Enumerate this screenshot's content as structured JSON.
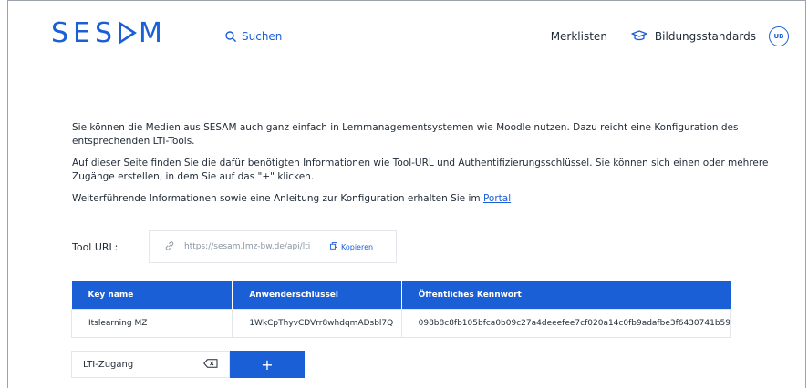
{
  "header": {
    "logo_text": "SESAM",
    "search_label": "Suchen",
    "nav_merklisten": "Merklisten",
    "nav_bildungsstandards": "Bildungsstandards",
    "avatar_initials": "UB"
  },
  "intro": {
    "p1": "Sie können die Medien aus SESAM auch ganz einfach in Lernmanagementsystemen wie Moodle nutzen. Dazu reicht eine Konfiguration des entsprechenden LTI-Tools.",
    "p2": "Auf dieser Seite finden Sie die dafür benötigten Informationen wie Tool-URL und Authentifizierungsschlüssel. Sie können sich einen oder mehrere Zugänge erstellen, in dem Sie auf das \"+\" klicken.",
    "p3_prefix": "Weiterführende Informationen sowie eine Anleitung zur Konfiguration erhalten Sie im ",
    "p3_link": "Portal"
  },
  "tool": {
    "label": "Tool URL:",
    "url": "https://sesam.lmz-bw.de/api/lti",
    "copy_label": "Kopieren"
  },
  "table": {
    "headers": [
      "Key name",
      "Anwenderschlüssel",
      "Öffentliches Kennwort"
    ],
    "rows": [
      [
        "Itslearning MZ",
        "1WkCpThyvCDVrr8whdqmADsbl7Q",
        "098b8c8fb105bfca0b09c27a4deeefee7cf020a14c0fb9adafbe3f6430741b59"
      ]
    ]
  },
  "add": {
    "input_value": "LTI-Zugang",
    "button_label": "+"
  },
  "colors": {
    "accent": "#1b5fd7",
    "text": "#1f2a37",
    "border": "#e3e7ec"
  }
}
